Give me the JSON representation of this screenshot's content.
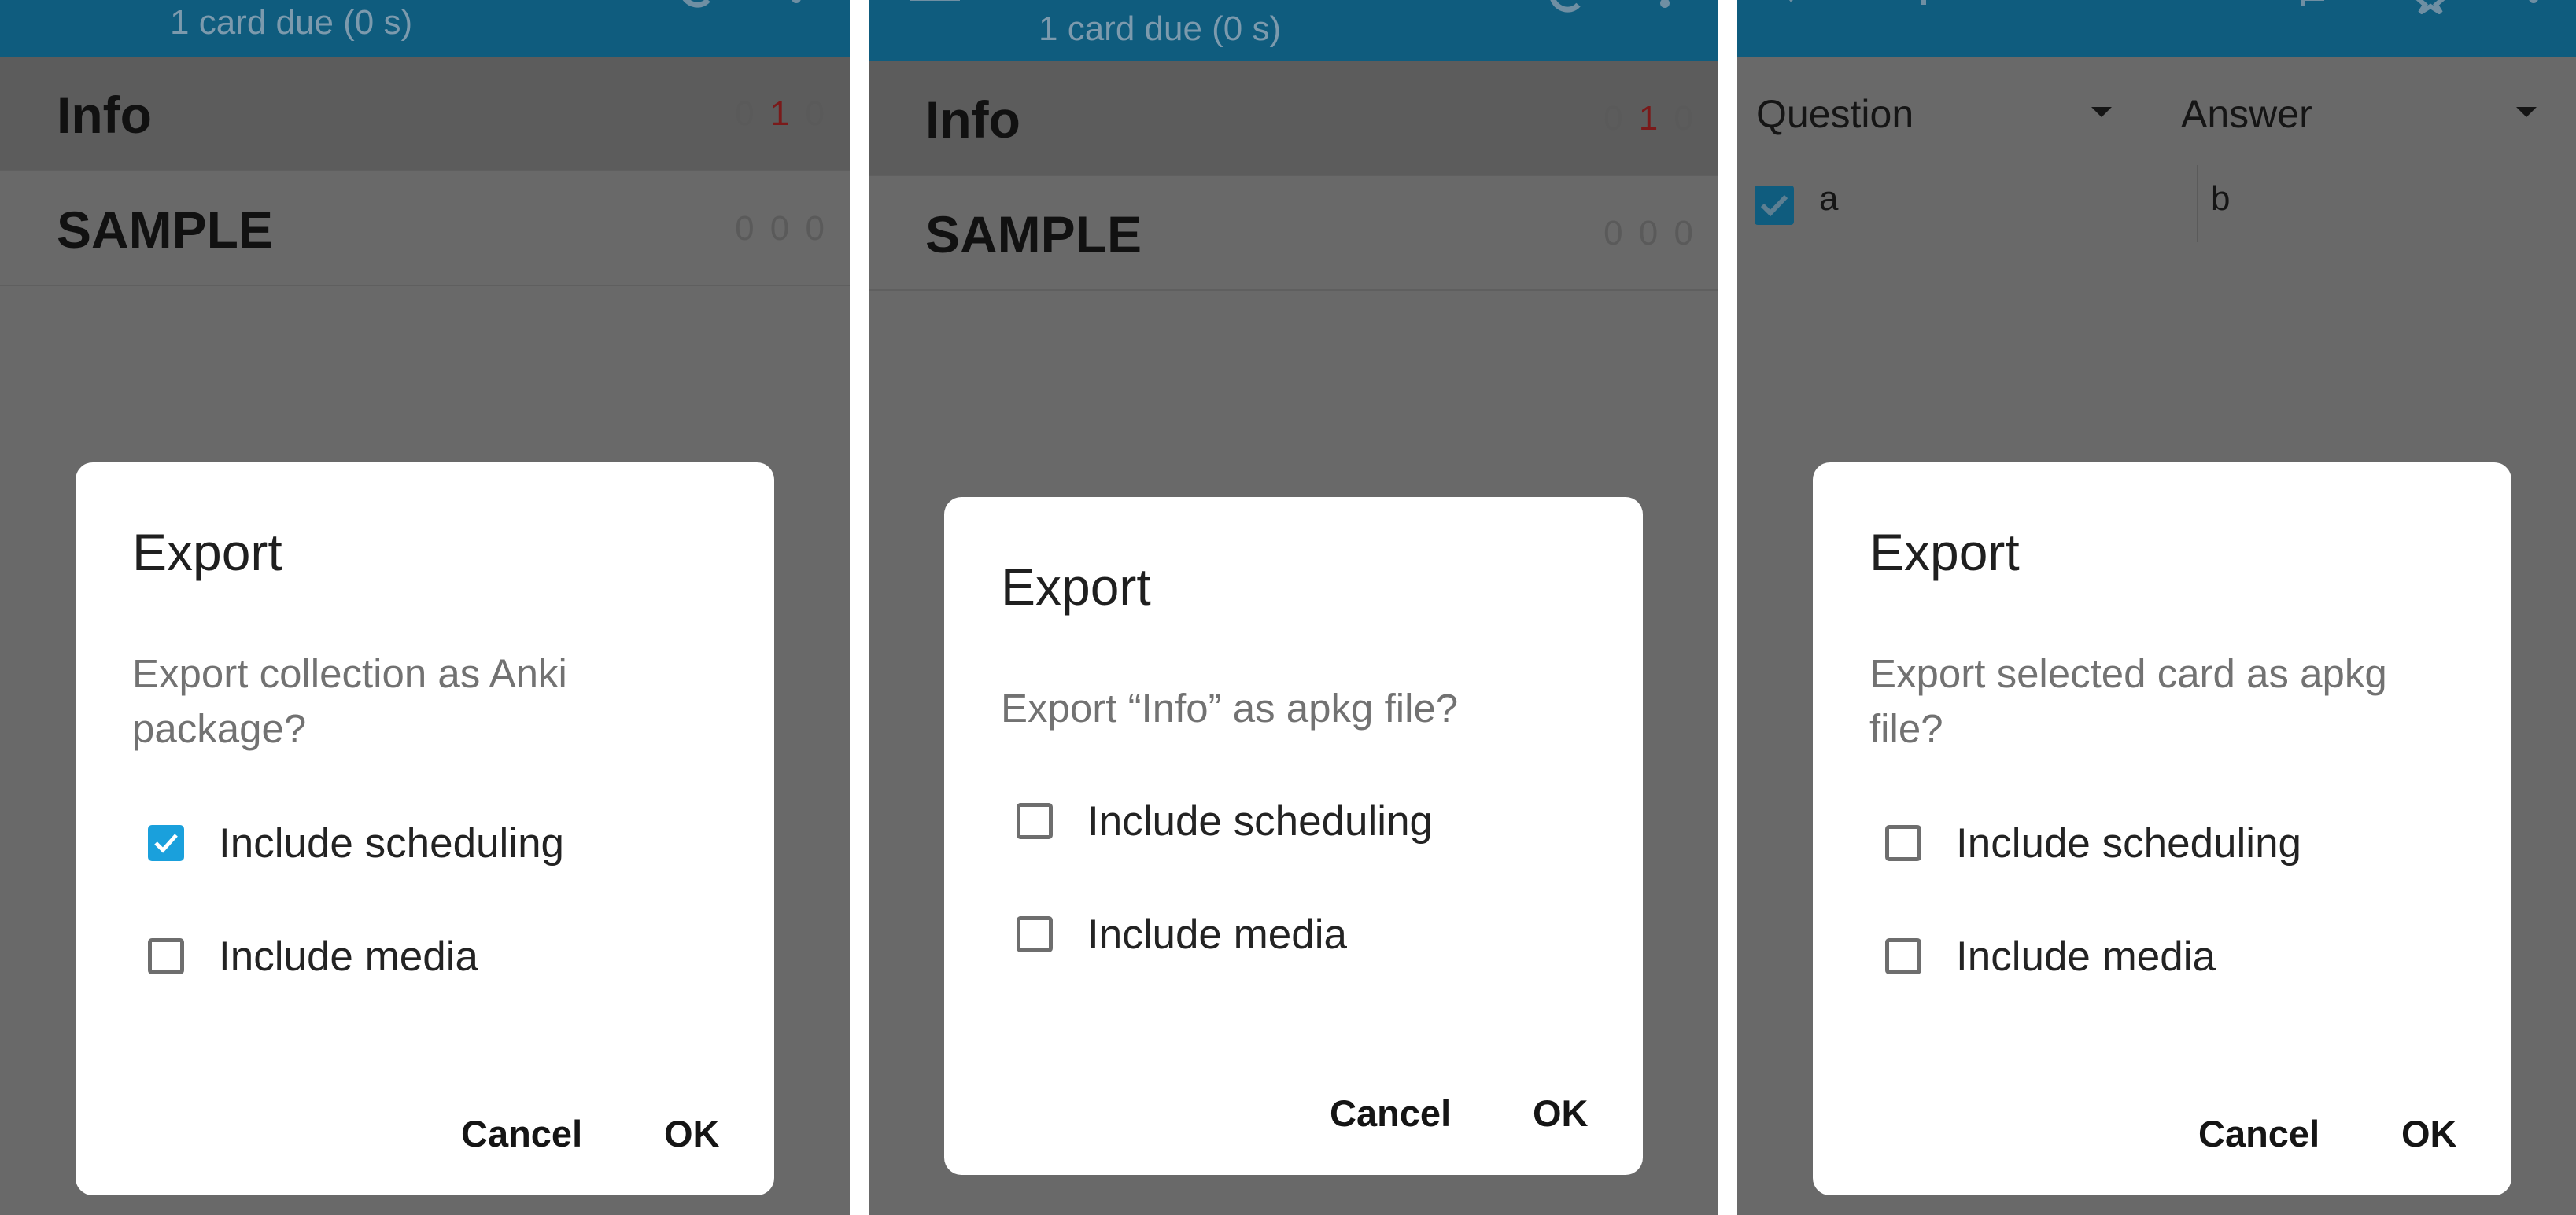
{
  "colors": {
    "app_bar": "#0f5c7e",
    "scrim": "#696969",
    "checkbox_checked": "#1aa0dc",
    "learn_count": "#7a1a1a"
  },
  "panels": [
    {
      "app_bar": {
        "subtitle": "1 card due (0 s)",
        "icons": [
          "menu-icon",
          "sync-icon",
          "overflow-menu-icon"
        ]
      },
      "decks": [
        {
          "name": "Info",
          "counts": {
            "new": "0",
            "learn": "1",
            "review": "0"
          }
        },
        {
          "name": "SAMPLE",
          "counts": {
            "new": "0",
            "learn": "0",
            "review": "0"
          }
        }
      ],
      "dialog": {
        "title": "Export",
        "message": "Export collection as Anki package?",
        "options": [
          {
            "label": "Include scheduling",
            "checked": true
          },
          {
            "label": "Include media",
            "checked": false
          }
        ],
        "cancel": "Cancel",
        "ok": "OK"
      }
    },
    {
      "app_bar": {
        "subtitle": "1 card due (0 s)",
        "icons": [
          "menu-icon",
          "sync-icon",
          "overflow-menu-icon"
        ]
      },
      "decks": [
        {
          "name": "Info",
          "counts": {
            "new": "0",
            "learn": "1",
            "review": "0"
          }
        },
        {
          "name": "SAMPLE",
          "counts": {
            "new": "0",
            "learn": "0",
            "review": "0"
          }
        }
      ],
      "dialog": {
        "title": "Export",
        "message": "Export “Info” as apkg file?",
        "options": [
          {
            "label": "Include scheduling",
            "checked": false
          },
          {
            "label": "Include media",
            "checked": false
          }
        ],
        "cancel": "Cancel",
        "ok": "OK"
      }
    },
    {
      "app_bar": {
        "icons": [
          "back-icon",
          "search-icon",
          "flag-icon",
          "star-icon",
          "overflow-menu-icon"
        ]
      },
      "browser": {
        "columns": [
          "Question",
          "Answer"
        ],
        "rows": [
          {
            "question": "a",
            "answer": "b",
            "selected": true
          }
        ]
      },
      "dialog": {
        "title": "Export",
        "message": "Export selected card as apkg file?",
        "options": [
          {
            "label": "Include scheduling",
            "checked": false
          },
          {
            "label": "Include media",
            "checked": false
          }
        ],
        "cancel": "Cancel",
        "ok": "OK"
      }
    }
  ]
}
